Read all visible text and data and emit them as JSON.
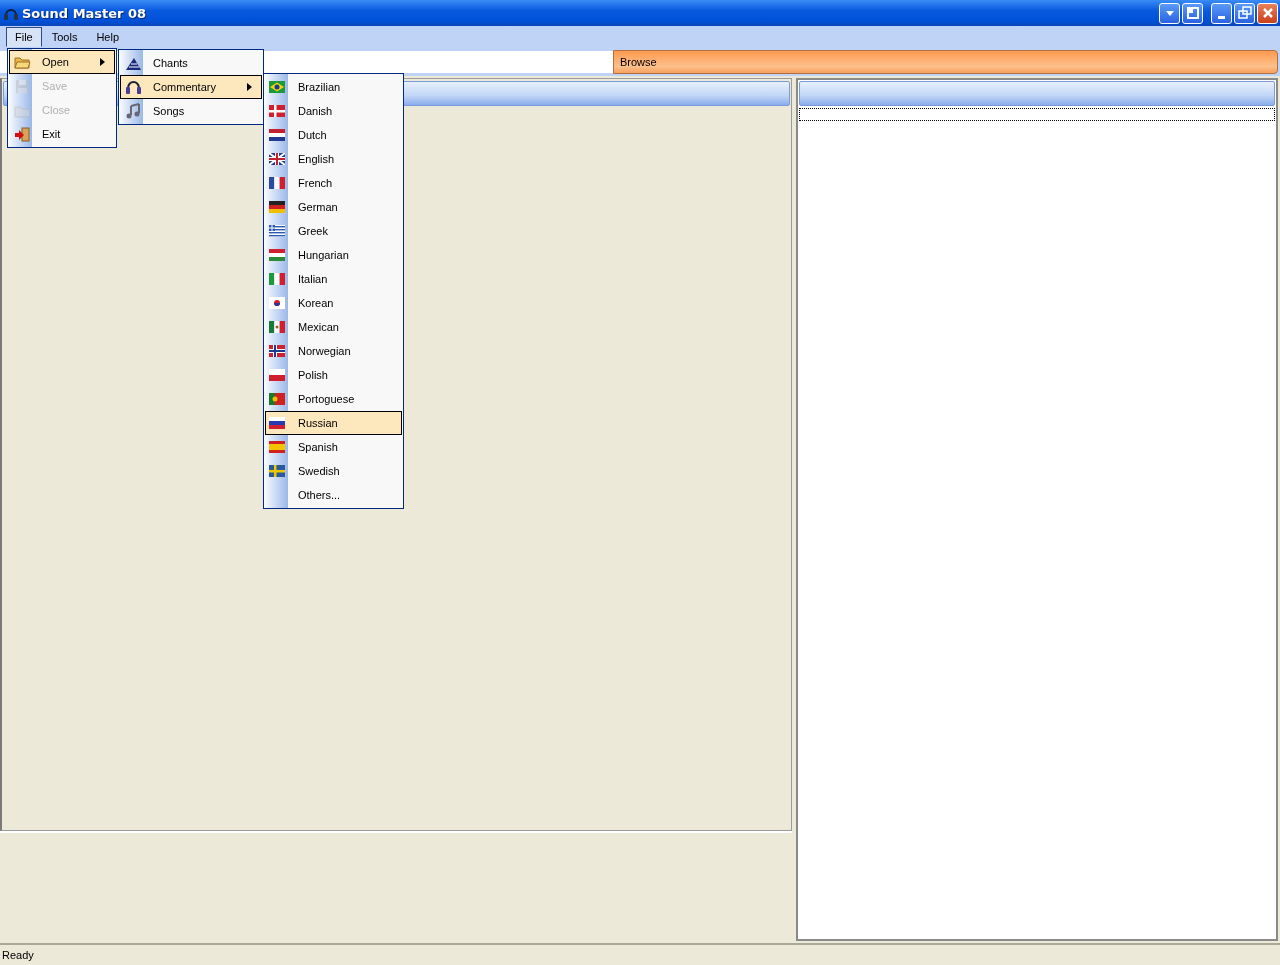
{
  "window": {
    "title": "Sound Master 08"
  },
  "menu_bar": [
    {
      "label": "File",
      "selected": true
    },
    {
      "label": "Tools",
      "selected": false
    },
    {
      "label": "Help",
      "selected": false
    }
  ],
  "toolbar": {
    "browse": "Browse"
  },
  "file_menu": [
    {
      "label": "Open",
      "kind": "open",
      "selected": true,
      "disabled": false,
      "submenu": true
    },
    {
      "label": "Save",
      "kind": "save",
      "selected": false,
      "disabled": true,
      "submenu": false
    },
    {
      "label": "Close",
      "kind": "close",
      "selected": false,
      "disabled": true,
      "submenu": false
    },
    {
      "label": "Exit",
      "kind": "exit",
      "selected": false,
      "disabled": false,
      "submenu": false
    }
  ],
  "open_menu": [
    {
      "label": "Chants",
      "kind": "chants",
      "selected": false,
      "submenu": false
    },
    {
      "label": "Commentary",
      "kind": "commentary",
      "selected": true,
      "submenu": true
    },
    {
      "label": "Songs",
      "kind": "songs",
      "selected": false,
      "submenu": false
    }
  ],
  "commentary_menu": [
    {
      "label": "Brazilian",
      "kind": "brazil",
      "selected": false
    },
    {
      "label": "Danish",
      "kind": "denmark",
      "selected": false
    },
    {
      "label": "Dutch",
      "kind": "netherlands",
      "selected": false
    },
    {
      "label": "English",
      "kind": "uk",
      "selected": false
    },
    {
      "label": "French",
      "kind": "france",
      "selected": false
    },
    {
      "label": "German",
      "kind": "germany",
      "selected": false
    },
    {
      "label": "Greek",
      "kind": "greece",
      "selected": false
    },
    {
      "label": "Hungarian",
      "kind": "hungary",
      "selected": false
    },
    {
      "label": "Italian",
      "kind": "italy",
      "selected": false
    },
    {
      "label": "Korean",
      "kind": "korea",
      "selected": false
    },
    {
      "label": "Mexican",
      "kind": "mexico",
      "selected": false
    },
    {
      "label": "Norwegian",
      "kind": "norway",
      "selected": false
    },
    {
      "label": "Polish",
      "kind": "poland",
      "selected": false
    },
    {
      "label": "Portoguese",
      "kind": "portugal",
      "selected": false
    },
    {
      "label": "Russian",
      "kind": "russia",
      "selected": true
    },
    {
      "label": "Spanish",
      "kind": "spain",
      "selected": false
    },
    {
      "label": "Swedish",
      "kind": "sweden",
      "selected": false
    },
    {
      "label": "Others...",
      "kind": "none",
      "selected": false
    }
  ],
  "status_bar": {
    "text": "Ready"
  }
}
